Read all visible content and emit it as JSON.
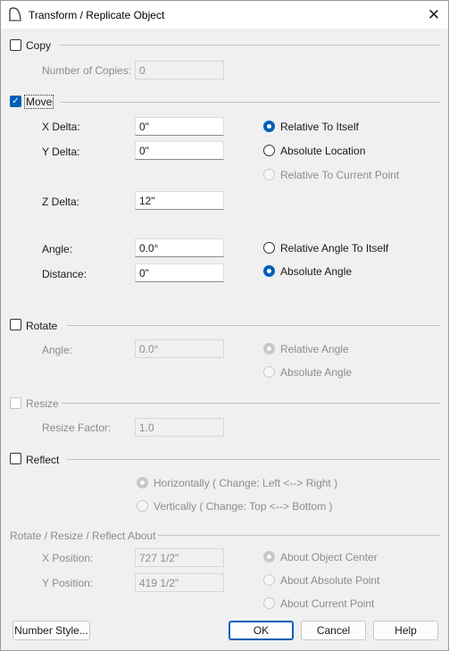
{
  "window": {
    "title": "Transform / Replicate Object"
  },
  "copy": {
    "label": "Copy",
    "checked": false,
    "copies_label": "Number of Copies:",
    "copies_value": "0"
  },
  "move": {
    "label": "Move",
    "checked": true,
    "x_label": "X Delta:",
    "x_value": "0\"",
    "y_label": "Y Delta:",
    "y_value": "0\"",
    "z_label": "Z Delta:",
    "z_value": "12\"",
    "angle_label": "Angle:",
    "angle_value": "0.0°",
    "distance_label": "Distance:",
    "distance_value": "0\"",
    "relative_itself": "Relative To Itself",
    "absolute_location": "Absolute Location",
    "relative_current_point": "Relative To Current Point",
    "relative_angle_itself": "Relative Angle To Itself",
    "absolute_angle": "Absolute Angle"
  },
  "rotate": {
    "label": "Rotate",
    "checked": false,
    "angle_label": "Angle:",
    "angle_value": "0.0°",
    "relative_angle": "Relative Angle",
    "absolute_angle": "Absolute Angle"
  },
  "resize": {
    "label": "Resize",
    "checked": false,
    "factor_label": "Resize Factor:",
    "factor_value": "1.0"
  },
  "reflect": {
    "label": "Reflect",
    "checked": false,
    "horizontally": "Horizontally ( Change: Left <--> Right )",
    "vertically": "Vertically ( Change: Top <--> Bottom )"
  },
  "about": {
    "label": "Rotate / Resize / Reflect About",
    "x_label": "X Position:",
    "x_value": "727 1/2\"",
    "y_label": "Y Position:",
    "y_value": "419 1/2\"",
    "object_center": "About Object Center",
    "absolute_point": "About Absolute Point",
    "current_point": "About Current Point"
  },
  "buttons": {
    "number_style": "Number Style...",
    "ok": "OK",
    "cancel": "Cancel",
    "help": "Help"
  },
  "colors": {
    "accent": "#005fb8",
    "disabled_text": "#8c8c8c"
  }
}
